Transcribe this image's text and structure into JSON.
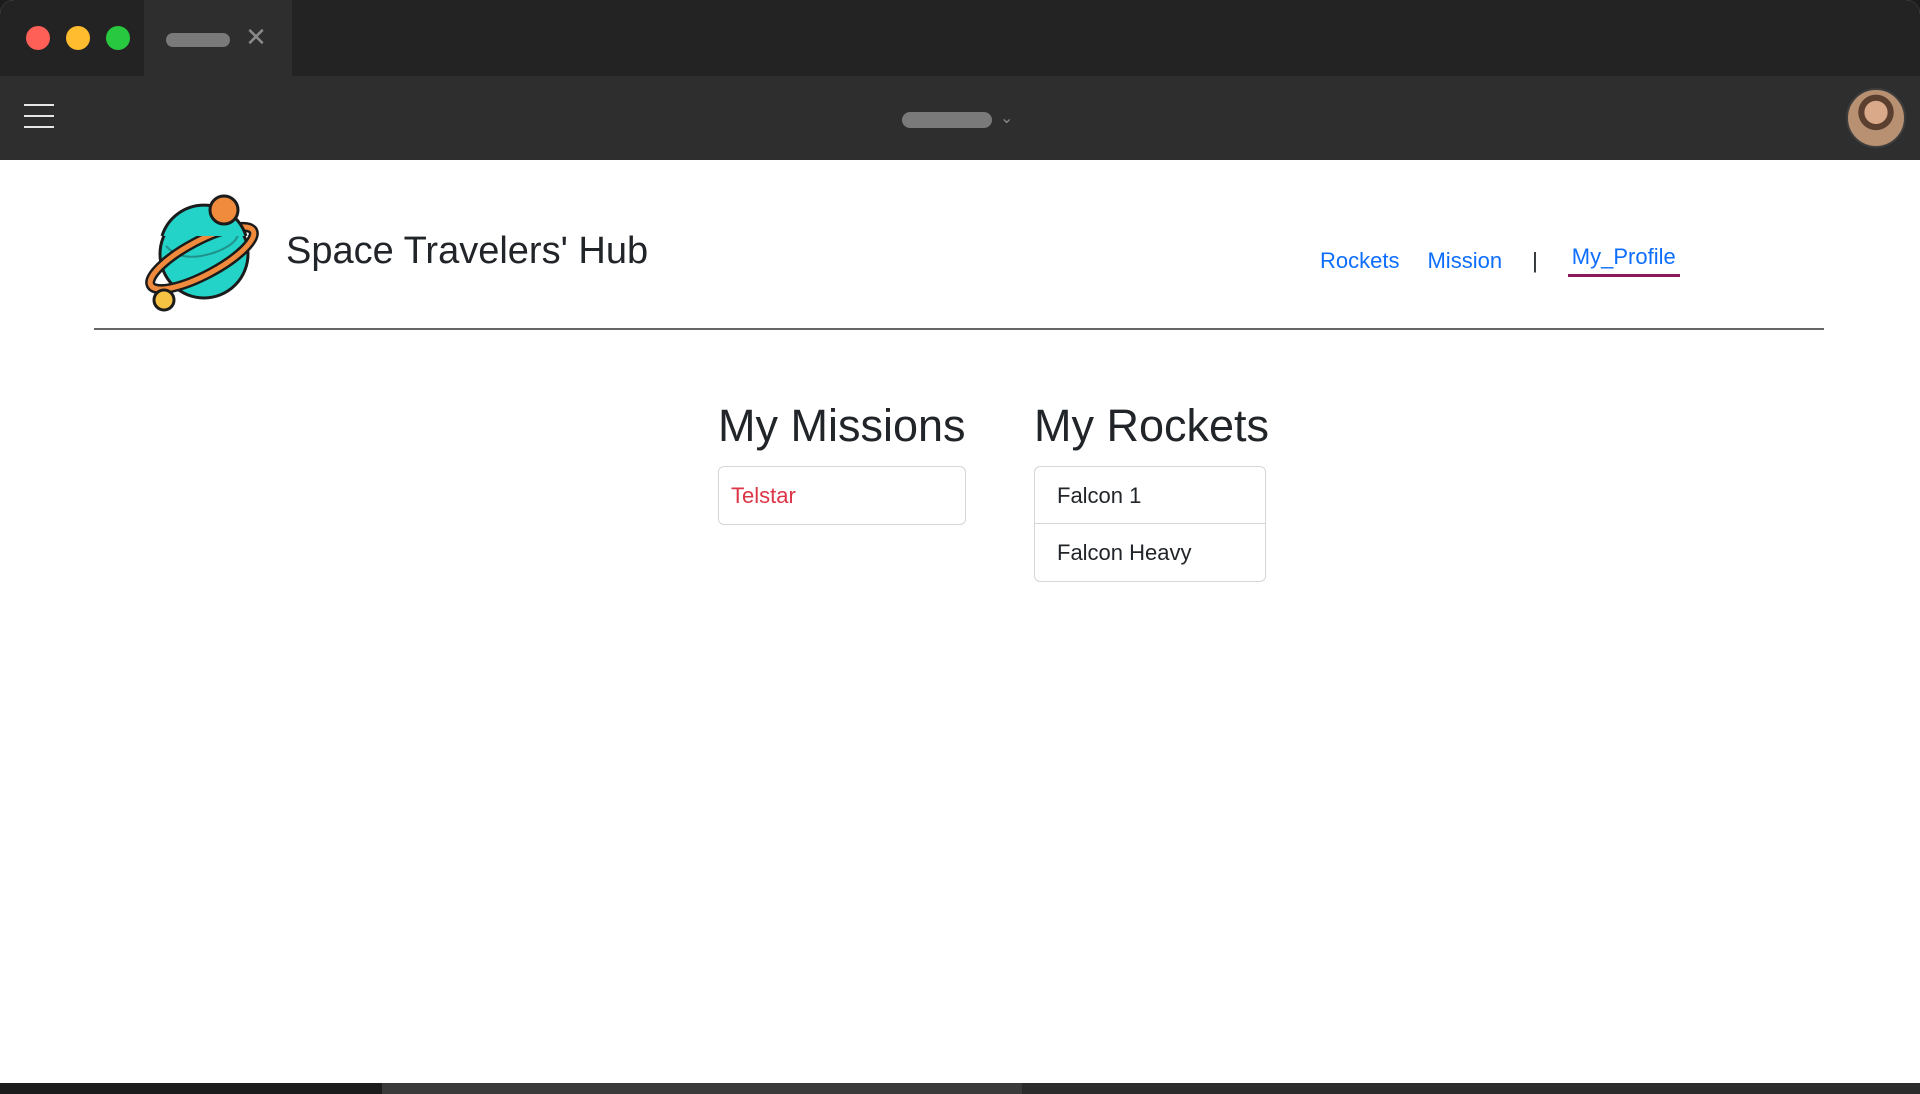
{
  "browser": {
    "tab_close_glyph": "✕",
    "address_chevron": "⌄",
    "colors": {
      "close": "#fe5f57",
      "minimize": "#febc2e",
      "maximize": "#28c840"
    }
  },
  "header": {
    "title": "Space Travelers' Hub",
    "nav": {
      "rockets": "Rockets",
      "mission": "Mission",
      "separator": "|",
      "profile": "My_Profile"
    }
  },
  "missions": {
    "heading": "My Missions",
    "items": [
      "Telstar"
    ]
  },
  "rockets": {
    "heading": "My Rockets",
    "items": [
      "Falcon 1",
      "Falcon Heavy"
    ]
  },
  "colors": {
    "link": "#0d6efd",
    "active_underline": "#8a1a5a",
    "mission_item": "#dc3545",
    "planet": "#23d3c8",
    "planet_outline": "#1b1b1b",
    "ring": "#f08a3c",
    "moon": "#f6c244"
  },
  "icons": [
    "hamburger-menu-icon",
    "avatar",
    "planet-logo-icon",
    "close-icon",
    "chevron-down-icon"
  ]
}
